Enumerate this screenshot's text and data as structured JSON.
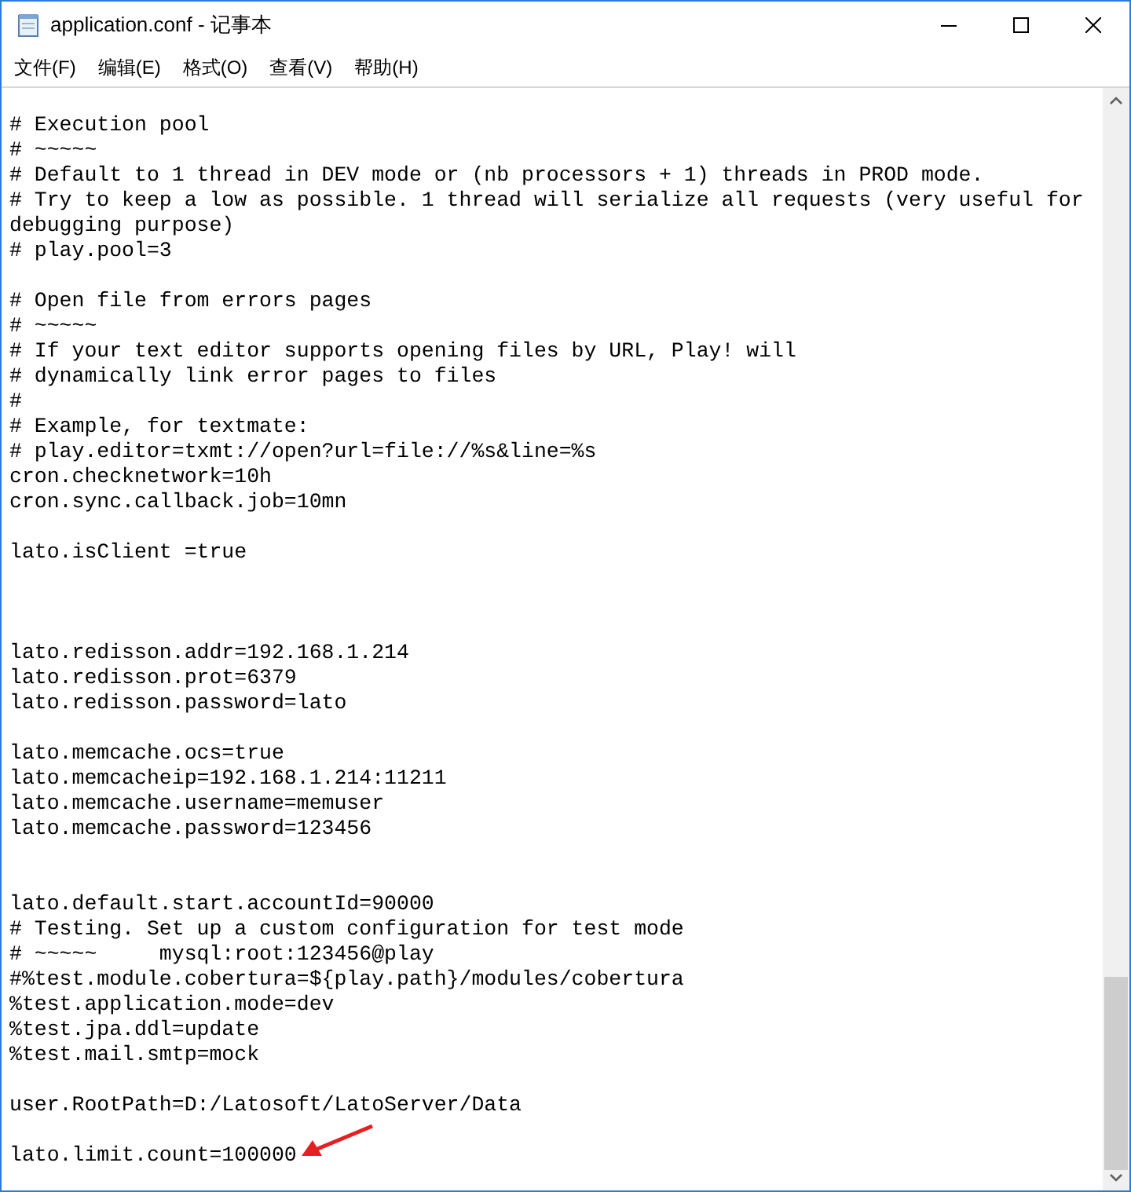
{
  "window": {
    "title": "application.conf - 记事本"
  },
  "menu": [
    "文件(F)",
    "编辑(E)",
    "格式(O)",
    "查看(V)",
    "帮助(H)"
  ],
  "lines": [
    {
      "kind": "text",
      "text": "# Execution pool"
    },
    {
      "kind": "text",
      "text": "# ~~~~~"
    },
    {
      "kind": "text",
      "text": "# Default to 1 thread in DEV mode or (nb processors + 1) threads in PROD mode."
    },
    {
      "kind": "text",
      "text": "# Try to keep a low as possible. 1 thread will serialize all requests (very useful for"
    },
    {
      "kind": "text",
      "text": "debugging purpose)"
    },
    {
      "kind": "text",
      "text": "# play.pool=3"
    },
    {
      "kind": "blank"
    },
    {
      "kind": "text",
      "text": "# Open file from errors pages"
    },
    {
      "kind": "text",
      "text": "# ~~~~~"
    },
    {
      "kind": "text",
      "text": "# If your text editor supports opening files by URL, Play! will"
    },
    {
      "kind": "text",
      "text": "# dynamically link error pages to files"
    },
    {
      "kind": "text",
      "text": "#"
    },
    {
      "kind": "text",
      "text": "# Example, for textmate:"
    },
    {
      "kind": "text",
      "text": "# play.editor=txmt://open?url=file://%s&line=%s"
    },
    {
      "kind": "text",
      "text": "cron.checknetwork=10h"
    },
    {
      "kind": "text",
      "text": "cron.sync.callback.job=10mn"
    },
    {
      "kind": "blank"
    },
    {
      "kind": "text",
      "text": "lato.isClient =true"
    },
    {
      "kind": "blank"
    },
    {
      "kind": "blank"
    },
    {
      "kind": "blank"
    },
    {
      "kind": "text",
      "text": "lato.redisson.addr=192.168.1.214"
    },
    {
      "kind": "text",
      "text": "lato.redisson.prot=6379"
    },
    {
      "kind": "text",
      "text": "lato.redisson.password=lato"
    },
    {
      "kind": "blank"
    },
    {
      "kind": "text",
      "text": "lato.memcache.ocs=true"
    },
    {
      "kind": "text",
      "text": "lato.memcacheip=192.168.1.214:11211"
    },
    {
      "kind": "text",
      "text": "lato.memcache.username=memuser"
    },
    {
      "kind": "text",
      "text": "lato.memcache.password=123456"
    },
    {
      "kind": "blank"
    },
    {
      "kind": "blank"
    },
    {
      "kind": "text",
      "text": "lato.default.start.accountId=90000"
    },
    {
      "kind": "text",
      "text": "# Testing. Set up a custom configuration for test mode"
    },
    {
      "kind": "text",
      "text": "# ~~~~~     mysql:root:123456@play"
    },
    {
      "kind": "text",
      "text": "#%test.module.cobertura=${play.path}/modules/cobertura"
    },
    {
      "kind": "text",
      "text": "%test.application.mode=dev"
    },
    {
      "kind": "text",
      "text": "%test.jpa.ddl=update"
    },
    {
      "kind": "text",
      "text": "%test.mail.smtp=mock"
    },
    {
      "kind": "blank"
    },
    {
      "kind": "text",
      "text": "user.RootPath=D:/Latosoft/LatoServer/Data"
    },
    {
      "kind": "blank"
    },
    {
      "kind": "text",
      "text": "lato.limit.count=100000",
      "arrow": true
    }
  ]
}
